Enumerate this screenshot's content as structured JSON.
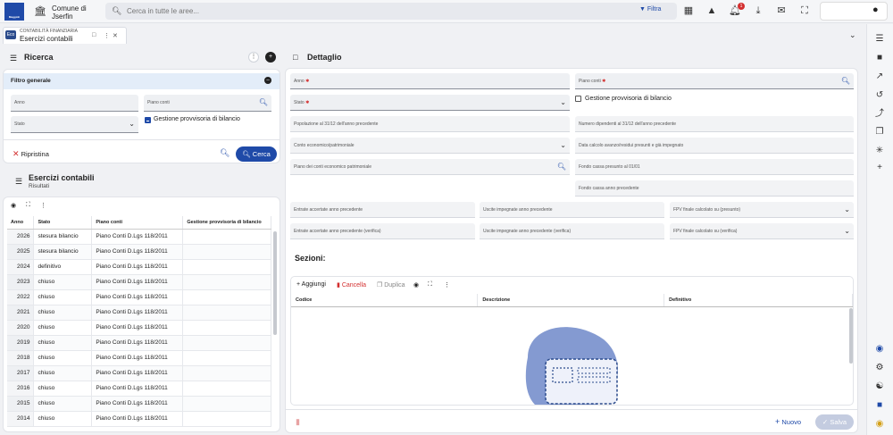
{
  "header": {
    "logo_text": "Maggioli",
    "org_line1": "Comune di",
    "org_line2": "Jserfin",
    "search_placeholder": "Cerca in tutte le aree...",
    "filter_label": "Filtra",
    "notification_count": "1"
  },
  "tab": {
    "section": "CONTABILITÀ FINANZIARIA",
    "title": "Esercizi contabili",
    "icon_text": "Eco"
  },
  "ricerca": {
    "title": "Ricerca",
    "filter_group": "Filtro generale",
    "anno_label": "Anno",
    "piano_label": "Piano conti",
    "stato_label": "Stato",
    "gestione_label": "Gestione provvisoria di bilancio",
    "reset_label": "Ripristina",
    "search_label": "Cerca"
  },
  "results": {
    "title": "Esercizi contabili",
    "subtitle": "Risultati",
    "columns": [
      "Anno",
      "Stato",
      "Piano conti",
      "Gestione provvisoria di bilancio"
    ],
    "rows": [
      [
        "2026",
        "stesura bilancio",
        "Piano Conti D.Lgs 118/2011",
        ""
      ],
      [
        "2025",
        "stesura bilancio",
        "Piano Conti D.Lgs 118/2011",
        ""
      ],
      [
        "2024",
        "definitivo",
        "Piano Conti D.Lgs 118/2011",
        ""
      ],
      [
        "2023",
        "chiuso",
        "Piano Conti D.Lgs 118/2011",
        ""
      ],
      [
        "2022",
        "chiuso",
        "Piano Conti D.Lgs 118/2011",
        ""
      ],
      [
        "2021",
        "chiuso",
        "Piano Conti D.Lgs 118/2011",
        ""
      ],
      [
        "2020",
        "chiuso",
        "Piano Conti D.Lgs 118/2011",
        ""
      ],
      [
        "2019",
        "chiuso",
        "Piano Conti D.Lgs 118/2011",
        ""
      ],
      [
        "2018",
        "chiuso",
        "Piano Conti D.Lgs 118/2011",
        ""
      ],
      [
        "2017",
        "chiuso",
        "Piano Conti D.Lgs 118/2011",
        ""
      ],
      [
        "2016",
        "chiuso",
        "Piano Conti D.Lgs 118/2011",
        ""
      ],
      [
        "2015",
        "chiuso",
        "Piano Conti D.Lgs 118/2011",
        ""
      ],
      [
        "2014",
        "chiuso",
        "Piano Conti D.Lgs 118/2011",
        ""
      ]
    ]
  },
  "dettaglio": {
    "title": "Dettaglio",
    "anno": "Anno",
    "piano_conti": "Piano conti",
    "stato": "Stato",
    "gestione": "Gestione provvisoria di bilancio",
    "popolazione": "Popolazione al 31/12 dell'anno precedente",
    "dipendenti": "Numero dipendenti al 31/12 dell'anno precedente",
    "conto_economico": "Conto economico/patrimoniale",
    "data_calcolo": "Data calcolo avanzo/residui presunti e già impegnato",
    "piano_economico": "Piano dei conti economico patrimoniale",
    "fondo_presunto": "Fondo cassa presunto al 01/01",
    "fondo_anno": "Fondo cassa anno precedente",
    "entrate": "Entrate accertate anno precedente",
    "uscite": "Uscite impegnate anno precedente",
    "fpv_presunto": "FPV finale calcolato su (presunto)",
    "entrate_verifica": "Entrate accertate anno precedente (verifica)",
    "uscite_verifica": "Uscite impegnate anno precedente (verifica)",
    "fpv_verifica": "FPV finale calcolato su (verifica)",
    "sezioni_title": "Sezioni:",
    "add_label": "Aggiungi",
    "delete_label": "Cancella",
    "duplicate_label": "Duplica",
    "sez_columns": [
      "Codice",
      "Descrizione",
      "Definitivo"
    ],
    "new_label": "Nuovo",
    "save_label": "Salva"
  },
  "colors": {
    "primary": "#1f4aa8",
    "danger": "#d32f2f",
    "filter_header_bg": "#e3edf9"
  }
}
